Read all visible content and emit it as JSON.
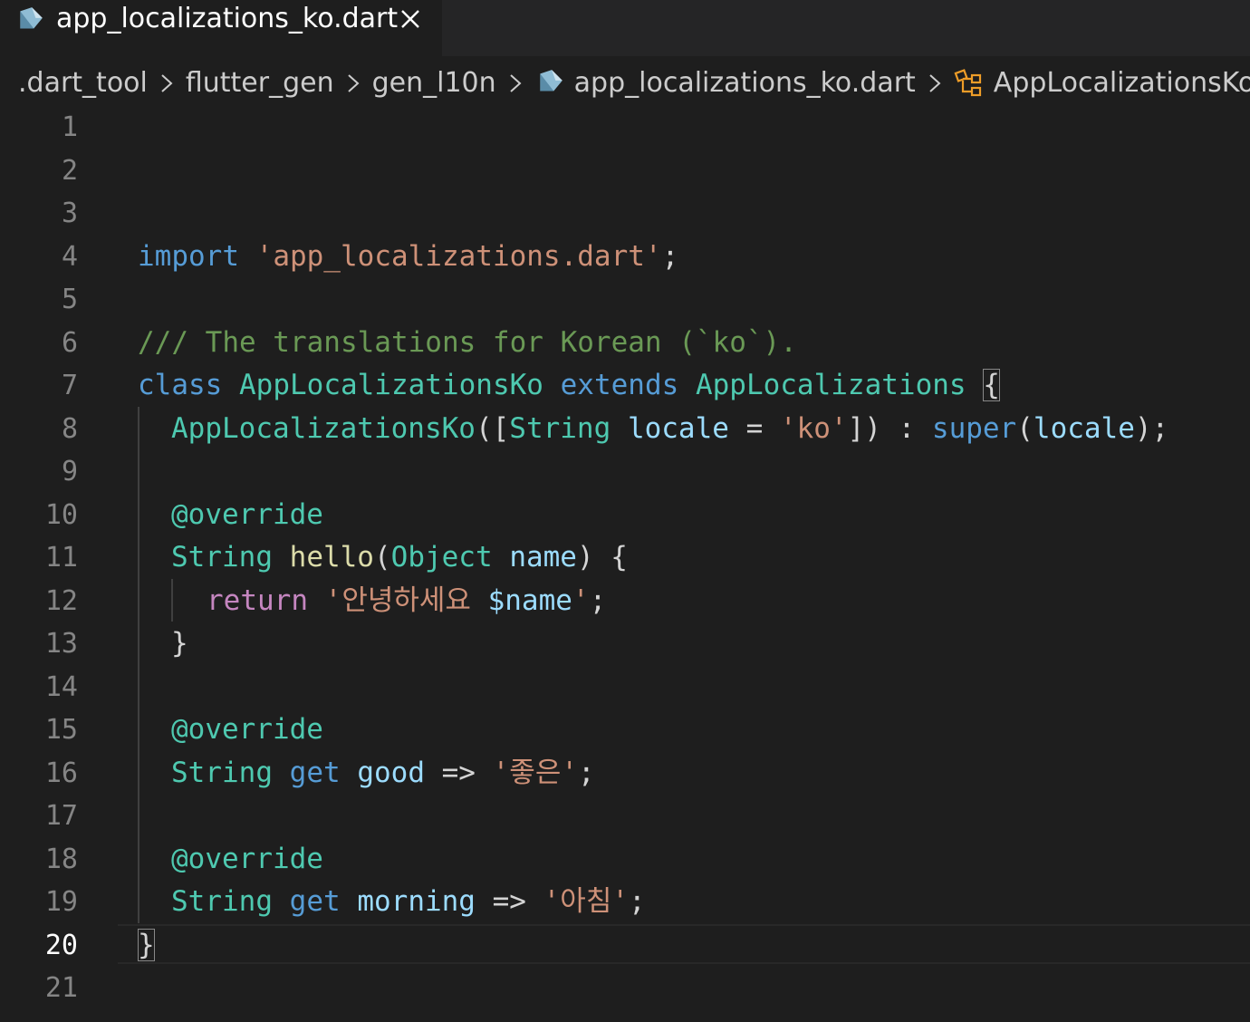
{
  "tab": {
    "title": "app_localizations_ko.dart",
    "close_glyph": "✕",
    "icon": "dart-file-icon"
  },
  "breadcrumb": {
    "items": [
      ".dart_tool",
      "flutter_gen",
      "gen_l10n",
      "app_localizations_ko.dart",
      "AppLocalizationsKo"
    ],
    "file_icon": "dart-file-icon",
    "class_icon": "class-symbol-icon"
  },
  "editor": {
    "active_line": 20,
    "line_numbers": [
      "1",
      "2",
      "3",
      "4",
      "5",
      "6",
      "7",
      "8",
      "9",
      "10",
      "11",
      "12",
      "13",
      "14",
      "15",
      "16",
      "17",
      "18",
      "19",
      "20",
      "21"
    ],
    "code": {
      "l4": {
        "kw_import": "import",
        "str": "'app_localizations.dart'",
        "semi": ";"
      },
      "l6": {
        "comment": "/// The translations for Korean (`ko`)."
      },
      "l7": {
        "kw_class": "class",
        "class_name": "AppLocalizationsKo",
        "kw_extends": "extends",
        "super_class": "AppLocalizations",
        "brace": "{"
      },
      "l8": {
        "ctor": "AppLocalizationsKo",
        "p1": "([",
        "type": "String",
        "param": "locale",
        "eq": " = ",
        "str": "'ko'",
        "p2": "]) : ",
        "kw_super": "super",
        "p3": "(",
        "arg": "locale",
        "p4": ");"
      },
      "l10": {
        "annotation": "@override"
      },
      "l11": {
        "type": "String",
        "method": "hello",
        "p1": "(",
        "ptype": "Object",
        "param": "name",
        "p2": ") {"
      },
      "l12": {
        "kw_return": "return",
        "str1": "'안녕하세요 ",
        "interp": "$name",
        "str2": "'",
        "semi": ";"
      },
      "l13": {
        "brace": "}"
      },
      "l15": {
        "annotation": "@override"
      },
      "l16": {
        "type": "String",
        "kw_get": "get",
        "name": "good",
        "arrow": " => ",
        "str": "'좋은'",
        "semi": ";"
      },
      "l18": {
        "annotation": "@override"
      },
      "l19": {
        "type": "String",
        "kw_get": "get",
        "name": "morning",
        "arrow": " => ",
        "str": "'아침'",
        "semi": ";"
      },
      "l20": {
        "brace": "}"
      }
    }
  },
  "colors": {
    "background": "#1e1e1e",
    "tabbar": "#252526",
    "keyword": "#569cd6",
    "string": "#ce9178",
    "comment": "#6a9955",
    "class": "#4ec9b0",
    "function": "#dcdcaa",
    "variable": "#9cdcfe",
    "control": "#c586c0",
    "class_symbol": "#ee9d28"
  }
}
